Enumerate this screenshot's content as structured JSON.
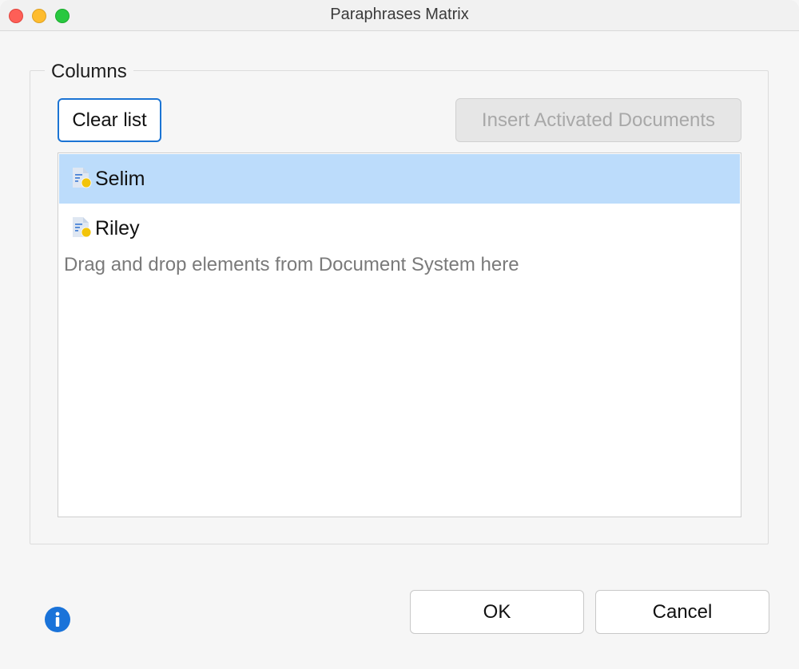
{
  "window": {
    "title": "Paraphrases Matrix"
  },
  "columns_group": {
    "legend": "Columns",
    "clear_label": "Clear list",
    "insert_label": "Insert Activated Documents",
    "items": [
      {
        "label": "Selim",
        "icon": "document-icon",
        "selected": true
      },
      {
        "label": "Riley",
        "icon": "document-icon",
        "selected": false
      }
    ],
    "hint": "Drag and drop elements from Document System here"
  },
  "footer": {
    "ok_label": "OK",
    "cancel_label": "Cancel",
    "info_icon": "info-icon"
  },
  "colors": {
    "selection": "#bcdcfb",
    "focus_border": "#1b74d4",
    "info": "#1a73d9",
    "doc_badge": "#f2c40a"
  }
}
